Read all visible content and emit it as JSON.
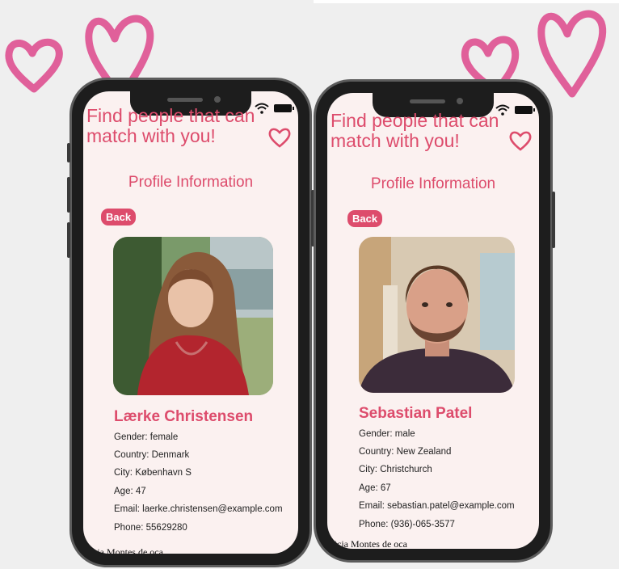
{
  "colors": {
    "accent": "#dd4c6c",
    "screen_bg": "#fbf1f0",
    "doodle": "#e0609a"
  },
  "icons": [
    "heart-doodle",
    "wifi-icon",
    "battery-icon",
    "heart-outline-icon"
  ],
  "screens": [
    {
      "headline": "Find people that can match with you!",
      "section_title": "Profile Information",
      "back_label": "Back",
      "name": "Lærke Christensen",
      "details": [
        "Gender: female",
        "Country: Denmark",
        "City: København S",
        "Age: 47",
        "Email: laerke.christensen@example.com",
        "Phone: 55629280"
      ],
      "credit": "atricia Montes de oca"
    },
    {
      "headline": "Find people that can match with you!",
      "section_title": "Profile Information",
      "back_label": "Back",
      "name": "Sebastian Patel",
      "details": [
        "Gender: male",
        "Country: New Zealand",
        "City: Christchurch",
        "Age: 67",
        "Email: sebastian.patel@example.com",
        "Phone: (936)-065-3577"
      ],
      "credit": "atricia Montes de oca"
    }
  ]
}
